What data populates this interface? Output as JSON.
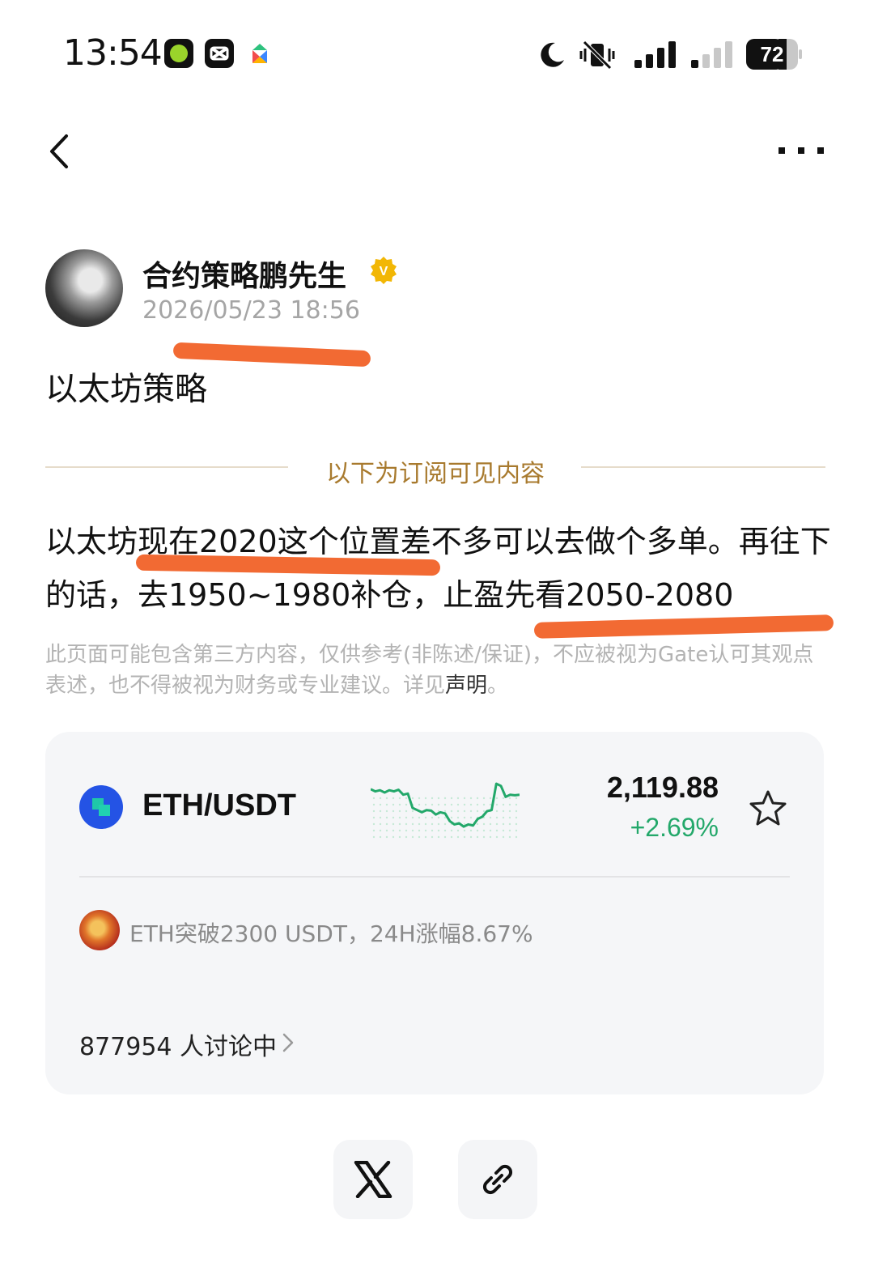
{
  "status_bar": {
    "time": "13:54",
    "battery": "72",
    "icons": [
      "app-icon-green",
      "capcut-icon",
      "puzzle-app-icon",
      "moon-icon",
      "vibrate-icon",
      "signal-icon",
      "signal-icon-secondary",
      "battery-icon"
    ]
  },
  "nav": {
    "back_icon": "chevron-left-icon",
    "more_icon": "more-horizontal-icon"
  },
  "author": {
    "name": "合约策略鹏先生",
    "verified_badge": "V",
    "time": "2026/05/23 18:56"
  },
  "post": {
    "title": "以太坊策略",
    "divider_label": "以下为订阅可见内容",
    "body": "以太坊现在2020这个位置差不多可以去做个多单。再往下的话，去1950~1980补仓，止盈先看2050-2080",
    "disclaimer_text": "此页面可能包含第三方内容，仅供参考(非陈述/保证)，不应被视为Gate认可其观点表述，也不得被视为财务或专业建议。详见",
    "disclaimer_link": "声明",
    "disclaimer_end": "。"
  },
  "market_card": {
    "pair": "ETH/USDT",
    "price": "2,119.88",
    "change": "+2.69%",
    "change_color": "#23a86a",
    "sparkline": [
      0.84,
      0.8,
      0.82,
      0.78,
      0.82,
      0.8,
      0.83,
      0.74,
      0.76,
      0.5,
      0.46,
      0.42,
      0.46,
      0.45,
      0.38,
      0.42,
      0.4,
      0.26,
      0.2,
      0.22,
      0.16,
      0.2,
      0.18,
      0.3,
      0.34,
      0.44,
      0.46,
      0.94,
      0.9,
      0.7,
      0.74,
      0.73,
      0.74
    ],
    "news": "ETH突破2300 USDT，24H涨幅8.67%",
    "discussion": "877954 人讨论中"
  },
  "share": {
    "buttons": [
      "x-icon",
      "link-icon"
    ]
  },
  "colors": {
    "accent_gold": "#a87a2e",
    "marker_orange": "#f26a33",
    "positive_green": "#23a86a"
  }
}
